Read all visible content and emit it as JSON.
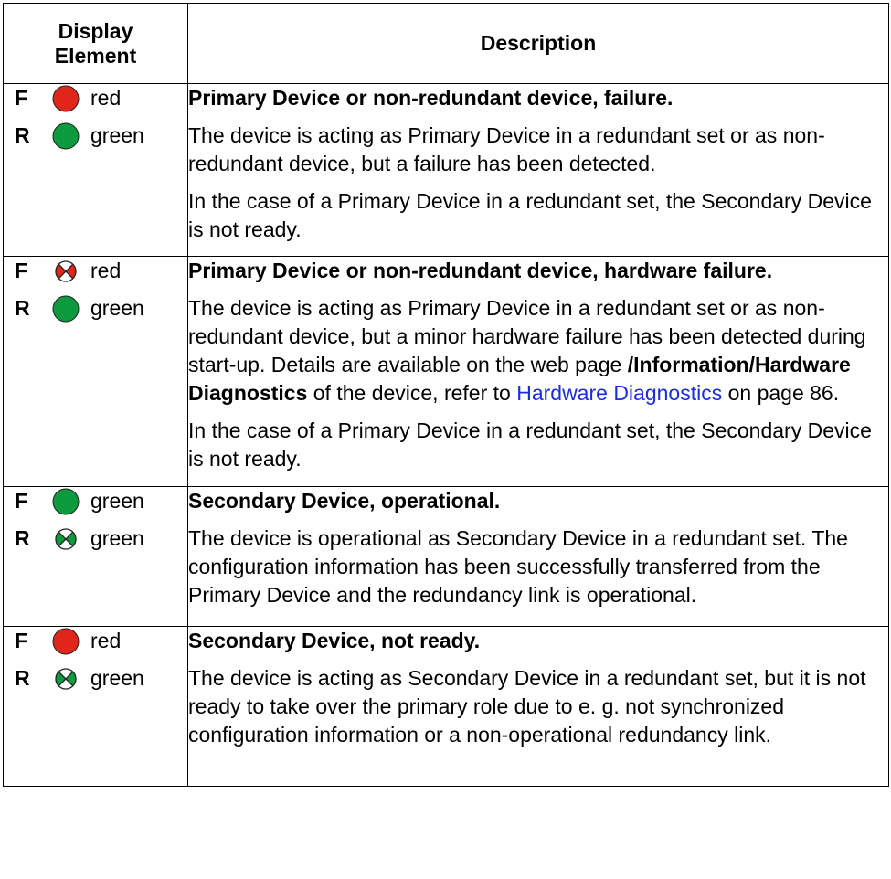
{
  "header": {
    "display_line1": "Display",
    "display_line2": "Element",
    "description": "Description"
  },
  "rows": [
    {
      "leds": [
        {
          "letter": "F",
          "color_name": "red",
          "lamp": "solid",
          "fill": "#e0251b"
        },
        {
          "letter": "R",
          "color_name": "green",
          "lamp": "solid",
          "fill": "#0c9a3f"
        }
      ],
      "title": "Primary Device or non-redundant device, failure.",
      "p1": "The device is acting as Primary Device in a redundant set or as non-redundant device, but a failure has been detected.",
      "p2": "In the case of a Primary Device in a redundant set, the Secondary Device is not ready."
    },
    {
      "leds": [
        {
          "letter": "F",
          "color_name": "red",
          "lamp": "flashing",
          "fill": "#e0251b"
        },
        {
          "letter": "R",
          "color_name": "green",
          "lamp": "solid",
          "fill": "#0c9a3f"
        }
      ],
      "title": "Primary Device or non-redundant device, hardware failure.",
      "p1_before": "The device is acting as Primary Device in a redundant set or as non-redundant device, but a minor hardware failure has been detected during start-up. Details are available on the web page ",
      "p1_path": "/Information/Hardware Diagnostics",
      "p1_middle": " of the device, refer to ",
      "p1_link": "Hardware Diagnostics",
      "p1_after": " on page 86.",
      "p2": "In the case of a Primary Device in a redundant set, the Secondary Device is not ready."
    },
    {
      "leds": [
        {
          "letter": "F",
          "color_name": "green",
          "lamp": "solid",
          "fill": "#0c9a3f"
        },
        {
          "letter": "R",
          "color_name": "green",
          "lamp": "flashing",
          "fill": "#0c9a3f"
        }
      ],
      "title": "Secondary Device, operational.",
      "p1": "The device is operational as Secondary Device in a redundant set. The configuration information has been successfully transferred from the Primary Device and the redundancy link is operational."
    },
    {
      "leds": [
        {
          "letter": "F",
          "color_name": "red",
          "lamp": "solid",
          "fill": "#e0251b"
        },
        {
          "letter": "R",
          "color_name": "green",
          "lamp": "flashing",
          "fill": "#0c9a3f"
        }
      ],
      "title": "Secondary Device, not ready.",
      "p1": "The device is acting as Secondary Device in a redundant set, but it is not ready to take over the primary role due to e. g. not synchronized configuration information or a non-operational redundancy link."
    }
  ]
}
